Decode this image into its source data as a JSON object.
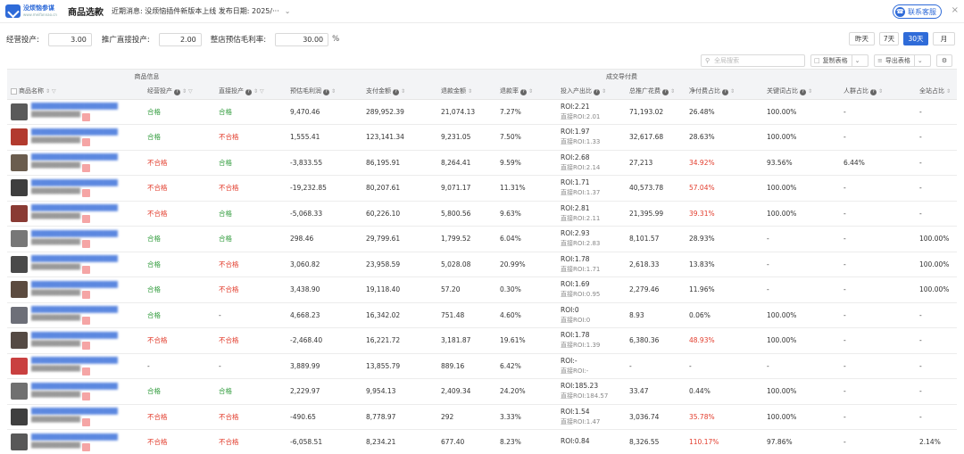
{
  "header": {
    "logo_title": "没烦恼参谋",
    "logo_sub": "www.meifannao.cn",
    "app_title": "商品选款",
    "notice": "近期消息: 没烦恼插件新版本上线 发布日期: 2025/···",
    "support_label": "联系客服"
  },
  "filters": {
    "op_label": "经营投产:",
    "op_value": "3.00",
    "promo_label": "推广直接投产:",
    "promo_value": "2.00",
    "margin_label": "整店预估毛利率:",
    "margin_value": "30.00",
    "pct": "%"
  },
  "dates": [
    "昨天",
    "7天",
    "30天",
    "月"
  ],
  "date_selected": "30天",
  "toolbar": {
    "search_placeholder": "全局搜索",
    "copy_label": "复制表格",
    "export_label": "导出表格"
  },
  "groups": {
    "product": "商品信息",
    "deal": "成交导付费"
  },
  "columns": [
    "商品名称",
    "经营投产",
    "直接投产",
    "预估毛利润",
    "支付金额",
    "退款金额",
    "退款率",
    "投入产出比",
    "总推广花费",
    "净付费占比",
    "关键词占比",
    "人群占比",
    "全站占比"
  ],
  "rows": [
    {
      "thumb": "#5a5a5a",
      "op": "合格",
      "pr": "合格",
      "profit": "9,470.46",
      "pay": "289,952.39",
      "refund": "21,074.13",
      "rate": "7.27%",
      "roi": "ROI:2.21",
      "droi": "直接ROI:2.01",
      "spend": "71,193.02",
      "net": "26.48%",
      "net_red": false,
      "kw": "100.00%",
      "crowd": "-",
      "site": "-"
    },
    {
      "thumb": "#b23a2e",
      "op": "合格",
      "pr": "不合格",
      "profit": "1,555.41",
      "pay": "123,141.34",
      "refund": "9,231.05",
      "rate": "7.50%",
      "roi": "ROI:1.97",
      "droi": "直接ROI:1.33",
      "spend": "32,617.68",
      "net": "28.63%",
      "net_red": false,
      "kw": "100.00%",
      "crowd": "-",
      "site": "-"
    },
    {
      "thumb": "#6b5d4e",
      "op": "不合格",
      "pr": "合格",
      "profit": "-3,833.55",
      "pay": "86,195.91",
      "refund": "8,264.41",
      "rate": "9.59%",
      "roi": "ROI:2.68",
      "droi": "直接ROI:2.14",
      "spend": "27,213",
      "net": "34.92%",
      "net_red": true,
      "kw": "93.56%",
      "crowd": "6.44%",
      "site": "-"
    },
    {
      "thumb": "#3e3e3e",
      "op": "不合格",
      "pr": "不合格",
      "profit": "-19,232.85",
      "pay": "80,207.61",
      "refund": "9,071.17",
      "rate": "11.31%",
      "roi": "ROI:1.71",
      "droi": "直接ROI:1.37",
      "spend": "40,573.78",
      "net": "57.04%",
      "net_red": true,
      "kw": "100.00%",
      "crowd": "-",
      "site": "-"
    },
    {
      "thumb": "#8a3b34",
      "op": "不合格",
      "pr": "合格",
      "profit": "-5,068.33",
      "pay": "60,226.10",
      "refund": "5,800.56",
      "rate": "9.63%",
      "roi": "ROI:2.81",
      "droi": "直接ROI:2.11",
      "spend": "21,395.99",
      "net": "39.31%",
      "net_red": true,
      "kw": "100.00%",
      "crowd": "-",
      "site": "-"
    },
    {
      "thumb": "#777777",
      "op": "合格",
      "pr": "合格",
      "profit": "298.46",
      "pay": "29,799.61",
      "refund": "1,799.52",
      "rate": "6.04%",
      "roi": "ROI:2.93",
      "droi": "直接ROI:2.83",
      "spend": "8,101.57",
      "net": "28.93%",
      "net_red": false,
      "kw": "-",
      "crowd": "-",
      "site": "100.00%"
    },
    {
      "thumb": "#4a4a4a",
      "op": "合格",
      "pr": "不合格",
      "profit": "3,060.82",
      "pay": "23,958.59",
      "refund": "5,028.08",
      "rate": "20.99%",
      "roi": "ROI:1.78",
      "droi": "直接ROI:1.71",
      "spend": "2,618.33",
      "net": "13.83%",
      "net_red": false,
      "kw": "-",
      "crowd": "-",
      "site": "100.00%"
    },
    {
      "thumb": "#5c4b3f",
      "op": "合格",
      "pr": "不合格",
      "profit": "3,438.90",
      "pay": "19,118.40",
      "refund": "57.20",
      "rate": "0.30%",
      "roi": "ROI:1.69",
      "droi": "直接ROI:0.95",
      "spend": "2,279.46",
      "net": "11.96%",
      "net_red": false,
      "kw": "-",
      "crowd": "-",
      "site": "100.00%"
    },
    {
      "thumb": "#6d6f78",
      "op": "合格",
      "pr": "-",
      "profit": "4,668.23",
      "pay": "16,342.02",
      "refund": "751.48",
      "rate": "4.60%",
      "roi": "ROI:0",
      "droi": "直接ROI:0",
      "spend": "8.93",
      "net": "0.06%",
      "net_red": false,
      "kw": "100.00%",
      "crowd": "-",
      "site": "-"
    },
    {
      "thumb": "#554a44",
      "op": "不合格",
      "pr": "不合格",
      "profit": "-2,468.40",
      "pay": "16,221.72",
      "refund": "3,181.87",
      "rate": "19.61%",
      "roi": "ROI:1.78",
      "droi": "直接ROI:1.39",
      "spend": "6,380.36",
      "net": "48.93%",
      "net_red": true,
      "kw": "100.00%",
      "crowd": "-",
      "site": "-"
    },
    {
      "thumb": "#c94040",
      "op": "-",
      "pr": "-",
      "profit": "3,889.99",
      "pay": "13,855.79",
      "refund": "889.16",
      "rate": "6.42%",
      "roi": "ROI:-",
      "droi": "直接ROI:-",
      "spend": "-",
      "net": "-",
      "net_red": false,
      "kw": "-",
      "crowd": "-",
      "site": "-"
    },
    {
      "thumb": "#707070",
      "op": "合格",
      "pr": "合格",
      "profit": "2,229.97",
      "pay": "9,954.13",
      "refund": "2,409.34",
      "rate": "24.20%",
      "roi": "ROI:185.23",
      "droi": "直接ROI:184.57",
      "spend": "33.47",
      "net": "0.44%",
      "net_red": false,
      "kw": "100.00%",
      "crowd": "-",
      "site": "-"
    },
    {
      "thumb": "#3f3f3f",
      "op": "不合格",
      "pr": "不合格",
      "profit": "-490.65",
      "pay": "8,778.97",
      "refund": "292",
      "rate": "3.33%",
      "roi": "ROI:1.54",
      "droi": "直接ROI:1.47",
      "spend": "3,036.74",
      "net": "35.78%",
      "net_red": true,
      "kw": "100.00%",
      "crowd": "-",
      "site": "-"
    },
    {
      "thumb": "#585858",
      "op": "不合格",
      "pr": "不合格",
      "profit": "-6,058.51",
      "pay": "8,234.21",
      "refund": "677.40",
      "rate": "8.23%",
      "roi": "ROI:0.84",
      "droi": "",
      "spend": "8,326.55",
      "net": "110.17%",
      "net_red": true,
      "kw": "97.86%",
      "crowd": "-",
      "site": "2.14%"
    }
  ]
}
